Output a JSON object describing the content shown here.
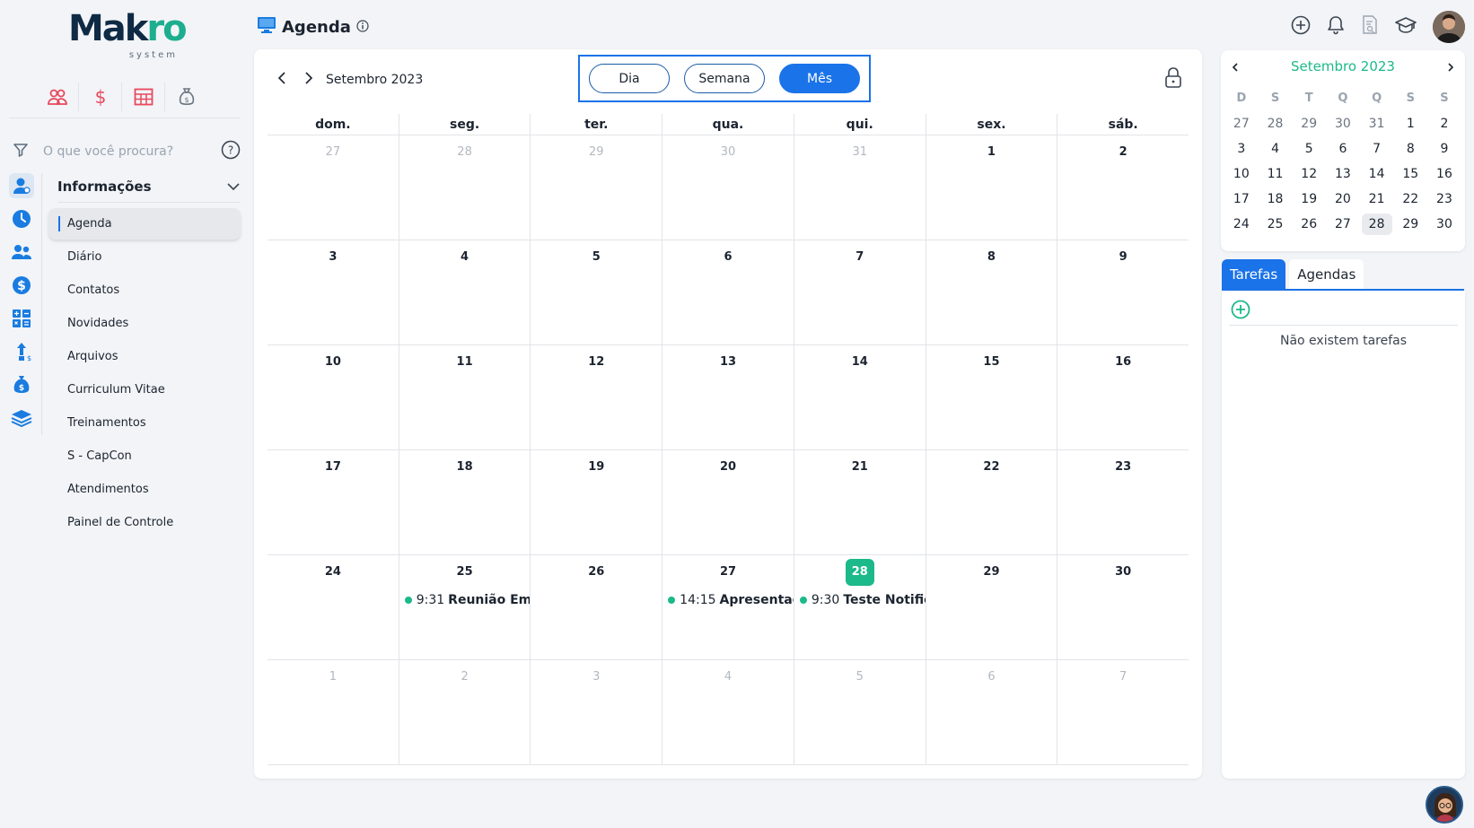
{
  "logo": {
    "main_a": "Mak",
    "main_b": "ro",
    "sub": "system"
  },
  "search": {
    "placeholder": "O que você procura?"
  },
  "menu": {
    "title": "Informações",
    "items": [
      {
        "label": "Agenda",
        "active": true
      },
      {
        "label": "Diário"
      },
      {
        "label": "Contatos"
      },
      {
        "label": "Novidades"
      },
      {
        "label": "Arquivos"
      },
      {
        "label": "Curriculum Vitae"
      },
      {
        "label": "Treinamentos"
      },
      {
        "label": "S - CapCon"
      },
      {
        "label": "Atendimentos"
      },
      {
        "label": "Painel de Controle"
      }
    ]
  },
  "header": {
    "title": "Agenda"
  },
  "calendar": {
    "month_label": "Setembro 2023",
    "views": {
      "day": "Dia",
      "week": "Semana",
      "month": "Mês",
      "active": "month"
    },
    "weekdays": [
      "dom.",
      "seg.",
      "ter.",
      "qua.",
      "qui.",
      "sex.",
      "sáb."
    ],
    "weeks": [
      [
        {
          "d": "27",
          "m": true
        },
        {
          "d": "28",
          "m": true
        },
        {
          "d": "29",
          "m": true
        },
        {
          "d": "30",
          "m": true
        },
        {
          "d": "31",
          "m": true
        },
        {
          "d": "1"
        },
        {
          "d": "2"
        }
      ],
      [
        {
          "d": "3"
        },
        {
          "d": "4"
        },
        {
          "d": "5"
        },
        {
          "d": "6"
        },
        {
          "d": "7"
        },
        {
          "d": "8"
        },
        {
          "d": "9"
        }
      ],
      [
        {
          "d": "10"
        },
        {
          "d": "11"
        },
        {
          "d": "12"
        },
        {
          "d": "13"
        },
        {
          "d": "14"
        },
        {
          "d": "15"
        },
        {
          "d": "16"
        }
      ],
      [
        {
          "d": "17"
        },
        {
          "d": "18"
        },
        {
          "d": "19"
        },
        {
          "d": "20"
        },
        {
          "d": "21"
        },
        {
          "d": "22"
        },
        {
          "d": "23"
        }
      ],
      [
        {
          "d": "24"
        },
        {
          "d": "25",
          "event": {
            "time": "9:31",
            "title": "Reunião Empr"
          }
        },
        {
          "d": "26"
        },
        {
          "d": "27",
          "event": {
            "time": "14:15",
            "title": "Apresentaçã"
          }
        },
        {
          "d": "28",
          "today": true,
          "event": {
            "time": "9:30",
            "title": "Teste Notifica"
          }
        },
        {
          "d": "29"
        },
        {
          "d": "30"
        }
      ],
      [
        {
          "d": "1",
          "m": true
        },
        {
          "d": "2",
          "m": true
        },
        {
          "d": "3",
          "m": true
        },
        {
          "d": "4",
          "m": true
        },
        {
          "d": "5",
          "m": true
        },
        {
          "d": "6",
          "m": true
        },
        {
          "d": "7",
          "m": true
        }
      ]
    ],
    "today_color": "#1cb98a",
    "accent_color": "#1a73e8"
  },
  "mini_calendar": {
    "month_label": "Setembro 2023",
    "weekdays": [
      "D",
      "S",
      "T",
      "Q",
      "Q",
      "S",
      "S"
    ],
    "weeks": [
      [
        "27",
        "28",
        "29",
        "30",
        "31",
        "1",
        "2"
      ],
      [
        "3",
        "4",
        "5",
        "6",
        "7",
        "8",
        "9"
      ],
      [
        "10",
        "11",
        "12",
        "13",
        "14",
        "15",
        "16"
      ],
      [
        "17",
        "18",
        "19",
        "20",
        "21",
        "22",
        "23"
      ],
      [
        "24",
        "25",
        "26",
        "27",
        "28",
        "29",
        "30"
      ]
    ],
    "selected": "28"
  },
  "side_tabs": {
    "tasks": "Tarefas",
    "agendas": "Agendas",
    "active": "tasks"
  },
  "tasks": {
    "empty_text": "Não existem tarefas"
  },
  "icons": [
    "plus-circle-icon",
    "bell-icon",
    "document-search-icon",
    "graduation-cap-icon",
    "filter-icon",
    "help-icon",
    "lock-icon",
    "monitor-icon",
    "info-icon"
  ]
}
